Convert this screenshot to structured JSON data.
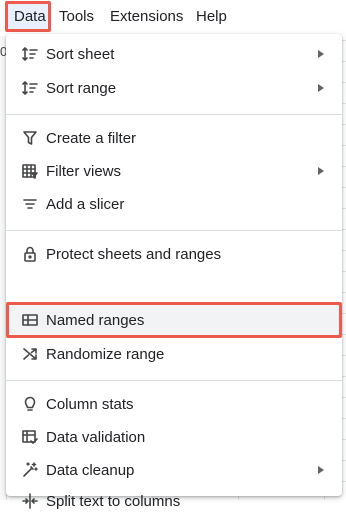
{
  "menubar": {
    "items": [
      {
        "label": "Data"
      },
      {
        "label": "Tools"
      },
      {
        "label": "Extensions"
      },
      {
        "label": "Help"
      }
    ]
  },
  "sheet": {
    "column_fragment": "0"
  },
  "menu": {
    "highlight_color": "#ee5b4c",
    "groups": [
      [
        {
          "label": "Sort sheet",
          "icon": "sort-icon",
          "submenu": true
        },
        {
          "label": "Sort range",
          "icon": "sort-icon",
          "submenu": true
        }
      ],
      [
        {
          "label": "Create a filter",
          "icon": "filter-icon",
          "submenu": false
        },
        {
          "label": "Filter views",
          "icon": "filter-views-icon",
          "submenu": true
        },
        {
          "label": "Add a slicer",
          "icon": "slicer-icon",
          "submenu": false
        }
      ],
      [
        {
          "label": "Protect sheets and ranges",
          "icon": "lock-icon",
          "submenu": false
        },
        {
          "label": "Named ranges",
          "icon": "named-ranges-icon",
          "submenu": false
        },
        {
          "label": "Randomize range",
          "icon": "shuffle-icon",
          "submenu": false
        }
      ],
      [
        {
          "label": "Column stats",
          "icon": "lightbulb-icon",
          "submenu": false
        },
        {
          "label": "Data validation",
          "icon": "data-validation-icon",
          "submenu": false
        },
        {
          "label": "Data cleanup",
          "icon": "magic-wand-icon",
          "submenu": true
        },
        {
          "label": "Split text to columns",
          "icon": "split-columns-icon",
          "submenu": false
        }
      ]
    ]
  }
}
